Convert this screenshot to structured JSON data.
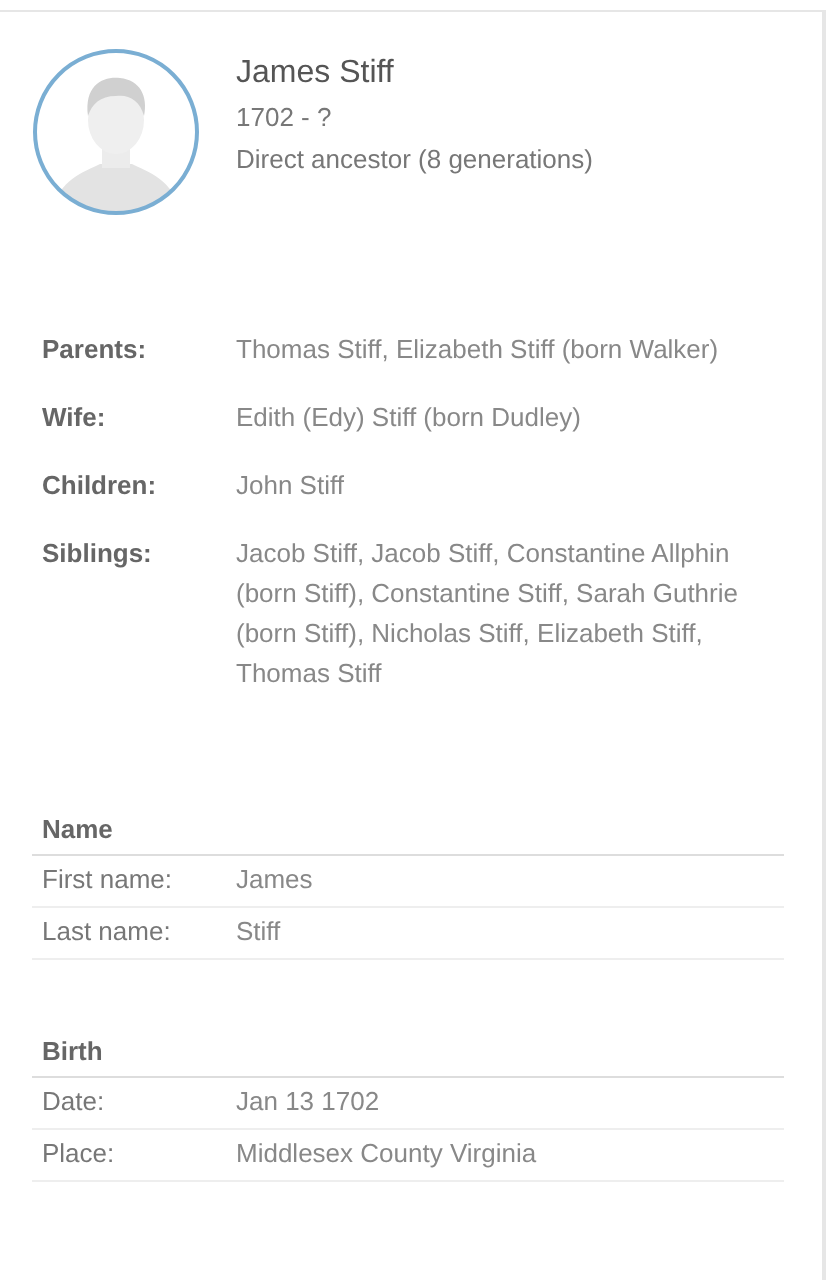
{
  "profile": {
    "name": "James Stiff",
    "lifespan": "1702 - ?",
    "relationship": "Direct ancestor (8 generations)"
  },
  "relations": [
    {
      "label": "Parents:",
      "value": "Thomas Stiff, Elizabeth Stiff (born Walker)"
    },
    {
      "label": "Wife:",
      "value": "Edith (Edy) Stiff (born Dudley)"
    },
    {
      "label": "Children:",
      "value": "John Stiff"
    },
    {
      "label": "Siblings:",
      "value": "Jacob Stiff, Jacob Stiff, Constantine Allphin (born Stiff), Constantine Stiff, Sarah Guthrie (born Stiff), Nicholas Stiff, Elizabeth Stiff, Thomas Stiff"
    }
  ],
  "sections": [
    {
      "title": "Name",
      "rows": [
        {
          "label": "First name:",
          "value": "James"
        },
        {
          "label": "Last name:",
          "value": "Stiff"
        }
      ]
    },
    {
      "title": "Birth",
      "rows": [
        {
          "label": "Date:",
          "value": "Jan 13 1702"
        },
        {
          "label": "Place:",
          "value": "Middlesex County Virginia"
        }
      ]
    }
  ]
}
